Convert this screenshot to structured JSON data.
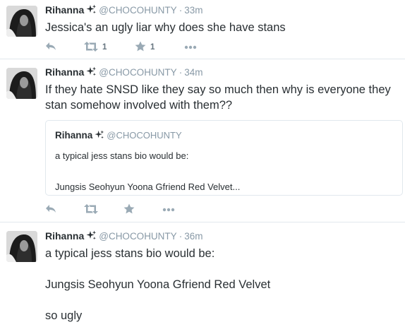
{
  "colors": {
    "text": "#292f33",
    "muted": "#8899a6",
    "action": "#9aaab5",
    "divider": "#e1e8ed"
  },
  "tweets": [
    {
      "author": {
        "name": "Rihanna",
        "handle": "@CHOCOHUNTY",
        "badge_icon": "sparkle-icon"
      },
      "time": "33m",
      "text": "Jessica's an ugly liar why does she have stans",
      "actions": {
        "reply_icon": "reply-icon",
        "retweet_count": "1",
        "like_count": "1",
        "more_icon": "more-icon"
      }
    },
    {
      "author": {
        "name": "Rihanna",
        "handle": "@CHOCOHUNTY",
        "badge_icon": "sparkle-icon"
      },
      "time": "34m",
      "text": "If they hate SNSD like they say so much then why is everyone they stan somehow involved with them??",
      "quote": {
        "author": {
          "name": "Rihanna",
          "handle": "@CHOCOHUNTY"
        },
        "text": "a typical jess stans bio would be:\n\nJungsis Seohyun Yoona Gfriend Red Velvet..."
      },
      "actions": {
        "reply_icon": "reply-icon",
        "retweet_icon": "retweet-icon",
        "like_icon": "star-icon",
        "more_icon": "more-icon"
      }
    },
    {
      "author": {
        "name": "Rihanna",
        "handle": "@CHOCOHUNTY",
        "badge_icon": "sparkle-icon"
      },
      "time": "36m",
      "text": "a typical jess stans bio would be:\n\nJungsis Seohyun Yoona Gfriend Red Velvet\n\nso ugly"
    }
  ]
}
